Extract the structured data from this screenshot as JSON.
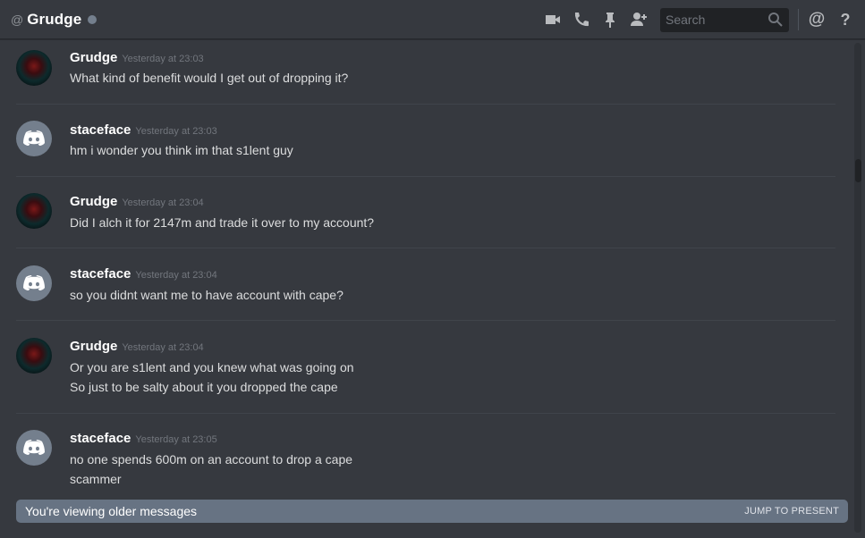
{
  "header": {
    "at_symbol": "@",
    "channel_name": "Grudge",
    "status_color": "#747f8d",
    "search_placeholder": "Search",
    "icons": [
      "video-call-icon",
      "voice-call-icon",
      "pin-icon",
      "add-friend-icon",
      "search-icon",
      "mention-icon",
      "help-icon"
    ],
    "mention_label": "@",
    "help_label": "?"
  },
  "messages": [
    {
      "author": "Grudge",
      "avatar": "grudge-avatar",
      "time": "Yesterday at 23:03",
      "lines": [
        "What kind of benefit would I get out of dropping it?"
      ]
    },
    {
      "author": "staceface",
      "avatar": "discord-default-avatar",
      "time": "Yesterday at 23:03",
      "lines": [
        "hm i wonder you think im that s1lent guy"
      ]
    },
    {
      "author": "Grudge",
      "avatar": "grudge-avatar",
      "time": "Yesterday at 23:04",
      "lines": [
        "Did I alch it for 2147m and trade it over to my account?"
      ]
    },
    {
      "author": "staceface",
      "avatar": "discord-default-avatar",
      "time": "Yesterday at 23:04",
      "lines": [
        "so you didnt want me to have account with cape?"
      ]
    },
    {
      "author": "Grudge",
      "avatar": "grudge-avatar",
      "time": "Yesterday at 23:04",
      "lines": [
        "Or you are s1lent and you knew what was going on",
        "So just to be salty about it you dropped the cape"
      ]
    },
    {
      "author": "staceface",
      "avatar": "discord-default-avatar",
      "time": "Yesterday at 23:05",
      "lines": [
        "no one spends 600m on an account to drop a cape",
        "scammer"
      ]
    }
  ],
  "older_bar": {
    "text": "You're viewing older messages",
    "jump_label": "JUMP TO PRESENT",
    "color": "#677383"
  },
  "colors": {
    "background": "#36393f",
    "text": "#dcddde",
    "username": "#ffffff",
    "timestamp": "#72767d"
  }
}
